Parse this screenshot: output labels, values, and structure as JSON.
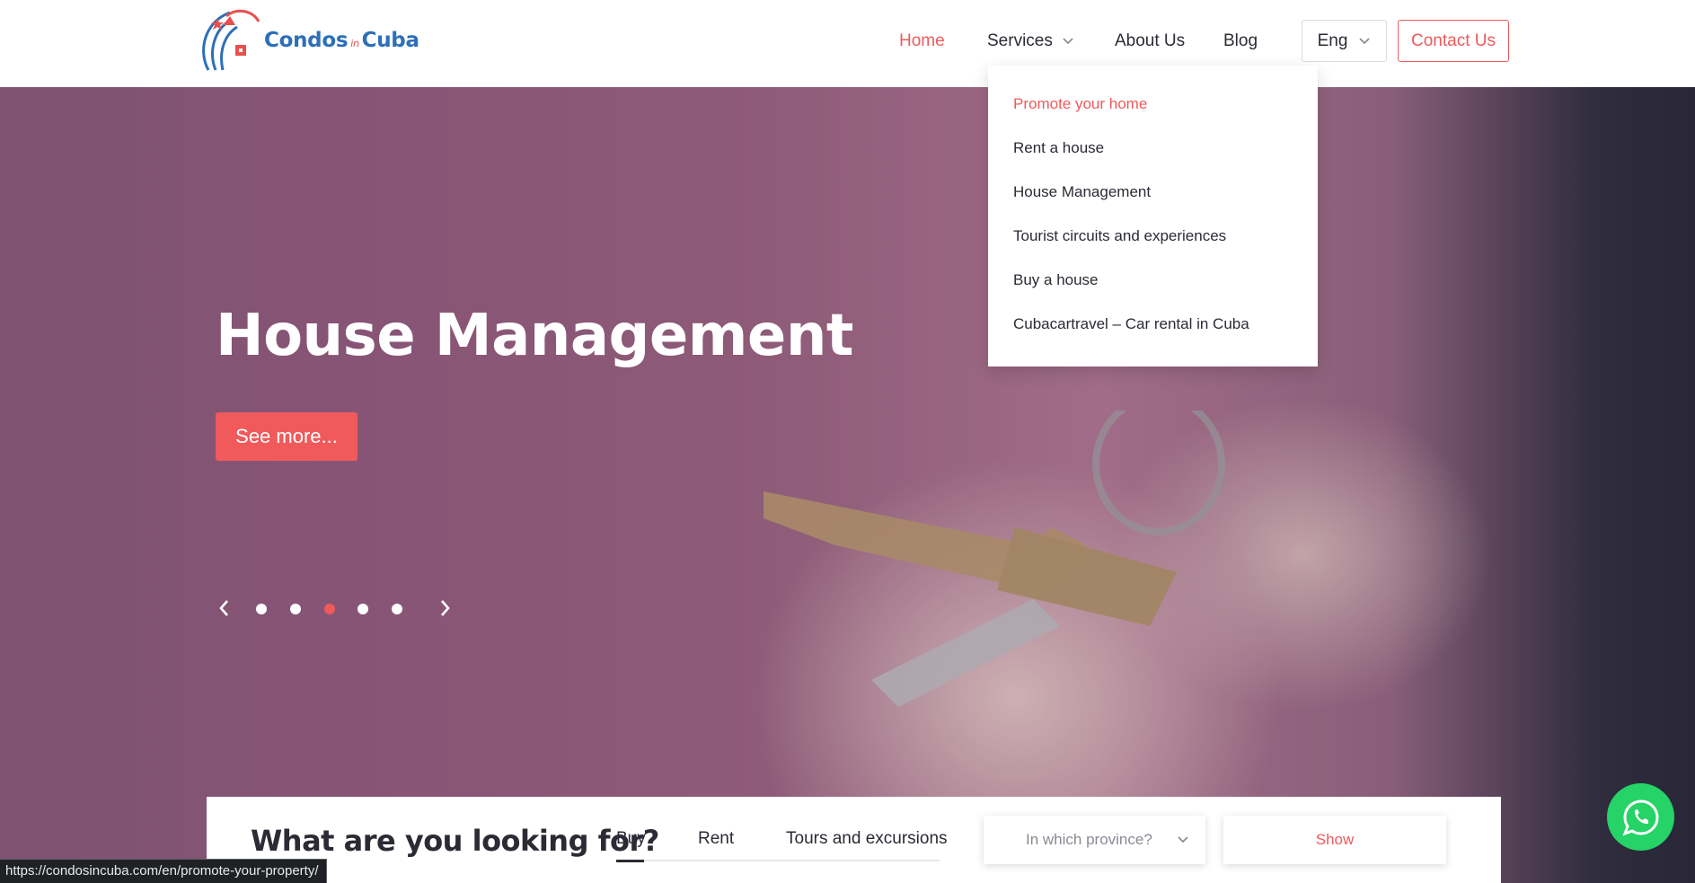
{
  "header": {
    "logo": {
      "brand_left": "Condos",
      "brand_mid": "in",
      "brand_right": "Cuba"
    },
    "nav": {
      "home": "Home",
      "services": "Services",
      "about": "About Us",
      "blog": "Blog"
    },
    "language": "Eng",
    "contact_label": "Contact Us"
  },
  "services_menu": {
    "items": [
      {
        "label": "Promote your home",
        "active": true
      },
      {
        "label": "Rent a house",
        "active": false
      },
      {
        "label": "House Management",
        "active": false
      },
      {
        "label": "Tourist circuits and experiences",
        "active": false
      },
      {
        "label": "Buy a house",
        "active": false
      },
      {
        "label": "Cubacartravel – Car rental in Cuba",
        "active": false
      }
    ]
  },
  "hero": {
    "title": "House Management",
    "cta_label": "See more...",
    "slides_count": 5,
    "active_slide": 3
  },
  "search": {
    "title": "What are you looking for?",
    "tabs": [
      "Buy",
      "Rent",
      "Tours and excursions"
    ],
    "active_tab": "Buy",
    "province_placeholder": "In which province?",
    "show_label": "Show"
  },
  "status_bar": {
    "url": "https://condosincuba.com/en/promote-your-property/"
  },
  "colors": {
    "accent": "#f05a5b",
    "brand_blue": "#2d6fb8",
    "whatsapp": "#25d366",
    "text": "#2b2b35"
  },
  "icons": {
    "services_chevron": "chevron-down-icon",
    "prev": "chevron-left-icon",
    "next": "chevron-right-icon",
    "whatsapp": "whatsapp-icon"
  }
}
